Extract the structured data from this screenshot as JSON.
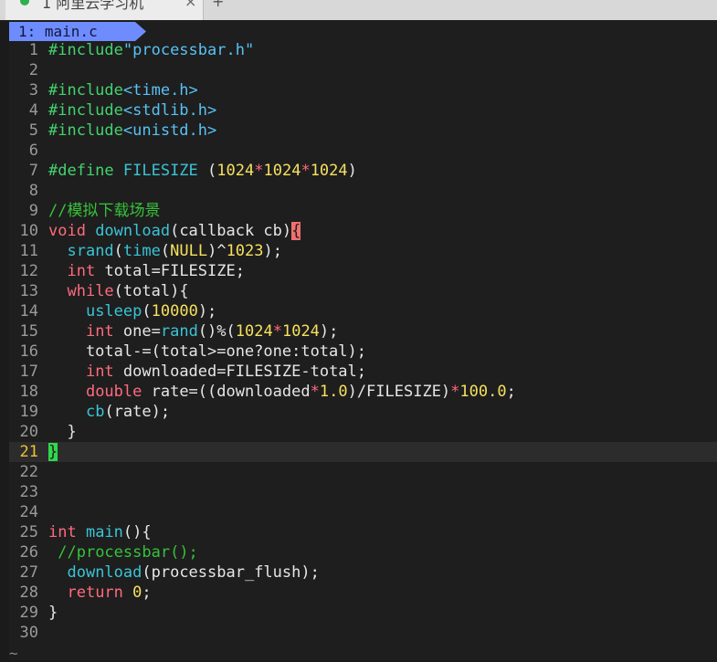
{
  "window": {
    "tab_title": "1 阿里云学习机",
    "tab_close": "×",
    "tab_add": "+"
  },
  "buffer": {
    "tab_label": "1: main.c"
  },
  "editor": {
    "cursor_line": 21,
    "lines": [
      {
        "n": "1",
        "tokens": [
          [
            "pp",
            "#include"
          ],
          [
            "str",
            "\"processbar.h\""
          ]
        ]
      },
      {
        "n": "2",
        "tokens": []
      },
      {
        "n": "3",
        "tokens": [
          [
            "pp",
            "#include"
          ],
          [
            "str",
            "<time.h>"
          ]
        ]
      },
      {
        "n": "4",
        "tokens": [
          [
            "pp",
            "#include"
          ],
          [
            "str",
            "<stdlib.h>"
          ]
        ]
      },
      {
        "n": "5",
        "tokens": [
          [
            "pp",
            "#include"
          ],
          [
            "str",
            "<unistd.h>"
          ]
        ]
      },
      {
        "n": "6",
        "tokens": []
      },
      {
        "n": "7",
        "tokens": [
          [
            "pp",
            "#define "
          ],
          [
            "fn",
            "FILESIZE"
          ],
          [
            "txt",
            " "
          ],
          [
            "txt",
            "("
          ],
          [
            "num",
            "1024"
          ],
          [
            "kw",
            "*"
          ],
          [
            "num",
            "1024"
          ],
          [
            "kw",
            "*"
          ],
          [
            "num",
            "1024"
          ],
          [
            "txt",
            ")"
          ]
        ]
      },
      {
        "n": "8",
        "tokens": []
      },
      {
        "n": "9",
        "tokens": [
          [
            "cm",
            "//模拟下载场景"
          ]
        ]
      },
      {
        "n": "10",
        "tokens": [
          [
            "kw",
            "void "
          ],
          [
            "fn",
            "download"
          ],
          [
            "txt",
            "(callback cb)"
          ],
          [
            "cursor-red",
            "{"
          ]
        ]
      },
      {
        "n": "11",
        "tokens": [
          [
            "txt",
            "  "
          ],
          [
            "fn",
            "srand"
          ],
          [
            "txt",
            "("
          ],
          [
            "fn",
            "time"
          ],
          [
            "txt",
            "("
          ],
          [
            "num",
            "NULL"
          ],
          [
            "txt",
            ")^"
          ],
          [
            "num",
            "1023"
          ],
          [
            "txt",
            ");"
          ]
        ]
      },
      {
        "n": "12",
        "tokens": [
          [
            "txt",
            "  "
          ],
          [
            "kw",
            "int"
          ],
          [
            "txt",
            " total=FILESIZE;"
          ]
        ]
      },
      {
        "n": "13",
        "tokens": [
          [
            "txt",
            "  "
          ],
          [
            "kw",
            "while"
          ],
          [
            "txt",
            "(total){"
          ]
        ]
      },
      {
        "n": "14",
        "tokens": [
          [
            "txt",
            "    "
          ],
          [
            "fn",
            "usleep"
          ],
          [
            "txt",
            "("
          ],
          [
            "num",
            "10000"
          ],
          [
            "txt",
            ");"
          ]
        ]
      },
      {
        "n": "15",
        "tokens": [
          [
            "txt",
            "    "
          ],
          [
            "kw",
            "int"
          ],
          [
            "txt",
            " one="
          ],
          [
            "fn",
            "rand"
          ],
          [
            "txt",
            "()%("
          ],
          [
            "num",
            "1024"
          ],
          [
            "kw",
            "*"
          ],
          [
            "num",
            "1024"
          ],
          [
            "txt",
            ");"
          ]
        ]
      },
      {
        "n": "16",
        "tokens": [
          [
            "txt",
            "    total-=(total>=one?one:total);"
          ]
        ]
      },
      {
        "n": "17",
        "tokens": [
          [
            "txt",
            "    "
          ],
          [
            "kw",
            "int"
          ],
          [
            "txt",
            " downloaded=FILESIZE-total;"
          ]
        ]
      },
      {
        "n": "18",
        "tokens": [
          [
            "txt",
            "    "
          ],
          [
            "kw",
            "double"
          ],
          [
            "txt",
            " rate=((downloaded"
          ],
          [
            "kw",
            "*"
          ],
          [
            "num",
            "1.0"
          ],
          [
            "txt",
            ")/FILESIZE)"
          ],
          [
            "kw",
            "*"
          ],
          [
            "num",
            "100.0"
          ],
          [
            "txt",
            ";"
          ]
        ]
      },
      {
        "n": "19",
        "tokens": [
          [
            "txt",
            "    "
          ],
          [
            "fn",
            "cb"
          ],
          [
            "txt",
            "(rate);"
          ]
        ]
      },
      {
        "n": "20",
        "tokens": [
          [
            "txt",
            "  }"
          ]
        ]
      },
      {
        "n": "21",
        "tokens": [
          [
            "cursor-green",
            "}"
          ]
        ]
      },
      {
        "n": "22",
        "tokens": []
      },
      {
        "n": "23",
        "tokens": []
      },
      {
        "n": "24",
        "tokens": []
      },
      {
        "n": "25",
        "tokens": [
          [
            "kw",
            "int "
          ],
          [
            "fn",
            "main"
          ],
          [
            "txt",
            "(){"
          ]
        ]
      },
      {
        "n": "26",
        "tokens": [
          [
            "txt",
            " "
          ],
          [
            "cm",
            "//processbar();"
          ]
        ]
      },
      {
        "n": "27",
        "tokens": [
          [
            "txt",
            "  "
          ],
          [
            "fn",
            "download"
          ],
          [
            "txt",
            "(processbar_flush);"
          ]
        ]
      },
      {
        "n": "28",
        "tokens": [
          [
            "txt",
            "  "
          ],
          [
            "kw",
            "return "
          ],
          [
            "num",
            "0"
          ],
          [
            "txt",
            ";"
          ]
        ]
      },
      {
        "n": "29",
        "tokens": [
          [
            "txt",
            "}"
          ]
        ]
      },
      {
        "n": "30",
        "tokens": []
      }
    ],
    "tilde": "~"
  }
}
